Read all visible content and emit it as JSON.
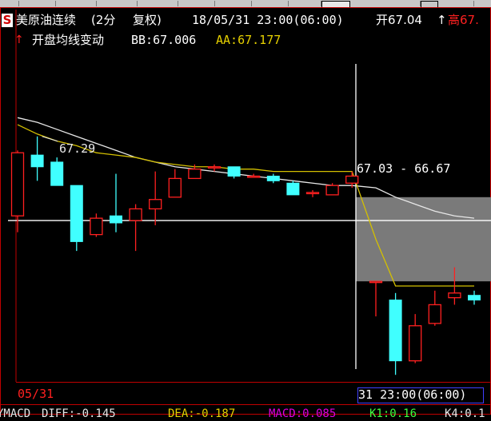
{
  "header": {
    "logo_glyph": "S",
    "instrument": "美原油连续",
    "period": "(2分",
    "adjust": "复权)",
    "datetime": "18/05/31 23:00(06:00)",
    "open_label": "开67.04",
    "high_label": "高67.",
    "open_arrow": "↑"
  },
  "indicator_line": {
    "arrow": "↑",
    "name": "开盘均线变动",
    "bb": "BB:67.006",
    "aa": "AA:67.177"
  },
  "annotations": {
    "peak_label": "67.29",
    "range_label": "67.03 - 66.67"
  },
  "time_axis": {
    "left_date": "05/31",
    "cursor_time": "31 23:00(06:00)"
  },
  "macd_bar": {
    "name": "YMACD",
    "diff": "DIFF:-0.145",
    "dea": "DEA:-0.187",
    "macd": "MACD:0.085",
    "k1": "K1:0.16",
    "k4": "K4:0.1"
  },
  "colors": {
    "up": "#ff2020",
    "down": "#40ffff",
    "ma_yellow": "#d4c000",
    "ma_white": "#e8e8e8",
    "frame": "#c00000"
  },
  "chart_data": {
    "type": "candlestick",
    "candles": [
      {
        "o": 66.95,
        "h": 67.23,
        "l": 66.88,
        "c": 67.22
      },
      {
        "o": 67.21,
        "h": 67.29,
        "l": 67.1,
        "c": 67.16
      },
      {
        "o": 67.18,
        "h": 67.2,
        "l": 67.09,
        "c": 67.08
      },
      {
        "o": 67.08,
        "h": 67.08,
        "l": 66.8,
        "c": 66.84
      },
      {
        "o": 66.87,
        "h": 66.96,
        "l": 66.86,
        "c": 66.94
      },
      {
        "o": 66.95,
        "h": 67.13,
        "l": 66.88,
        "c": 66.92
      },
      {
        "o": 66.93,
        "h": 67.0,
        "l": 66.8,
        "c": 66.98
      },
      {
        "o": 66.98,
        "h": 67.14,
        "l": 66.91,
        "c": 67.02
      },
      {
        "o": 67.03,
        "h": 67.15,
        "l": 67.03,
        "c": 67.11
      },
      {
        "o": 67.11,
        "h": 67.17,
        "l": 67.11,
        "c": 67.15
      },
      {
        "o": 67.16,
        "h": 67.17,
        "l": 67.14,
        "c": 67.16
      },
      {
        "o": 67.16,
        "h": 67.16,
        "l": 67.11,
        "c": 67.12
      },
      {
        "o": 67.12,
        "h": 67.13,
        "l": 67.12,
        "c": 67.12
      },
      {
        "o": 67.12,
        "h": 67.13,
        "l": 67.09,
        "c": 67.1
      },
      {
        "o": 67.09,
        "h": 67.1,
        "l": 67.04,
        "c": 67.04
      },
      {
        "o": 67.05,
        "h": 67.06,
        "l": 67.03,
        "c": 67.05
      },
      {
        "o": 67.04,
        "h": 67.09,
        "l": 67.04,
        "c": 67.08
      },
      {
        "o": 67.09,
        "h": 67.14,
        "l": 67.07,
        "c": 67.12
      },
      {
        "o": 66.67,
        "h": 66.67,
        "l": 66.52,
        "c": 66.67
      },
      {
        "o": 66.59,
        "h": 66.62,
        "l": 66.27,
        "c": 66.33
      },
      {
        "o": 66.33,
        "h": 66.53,
        "l": 66.32,
        "c": 66.48
      },
      {
        "o": 66.49,
        "h": 66.63,
        "l": 66.48,
        "c": 66.57
      },
      {
        "o": 66.6,
        "h": 66.73,
        "l": 66.57,
        "c": 66.62
      },
      {
        "o": 66.61,
        "h": 66.63,
        "l": 66.57,
        "c": 66.59
      }
    ],
    "ma_yellow": [
      67.34,
      67.3,
      67.27,
      67.25,
      67.22,
      67.21,
      67.2,
      67.18,
      67.17,
      67.16,
      67.16,
      67.15,
      67.15,
      67.14,
      67.14,
      67.14,
      67.14,
      67.14,
      66.85,
      66.65,
      66.65,
      66.65,
      66.65,
      66.65
    ],
    "ma_white": [
      67.37,
      67.35,
      67.32,
      67.29,
      67.26,
      67.23,
      67.2,
      67.18,
      67.16,
      67.15,
      67.14,
      67.13,
      67.12,
      67.11,
      67.1,
      67.09,
      67.08,
      67.08,
      67.07,
      67.03,
      67.0,
      66.97,
      66.95,
      66.94
    ],
    "hline": 66.93,
    "shaded_range": [
      67.03,
      66.67
    ],
    "ylim": [
      66.24,
      67.6
    ]
  }
}
